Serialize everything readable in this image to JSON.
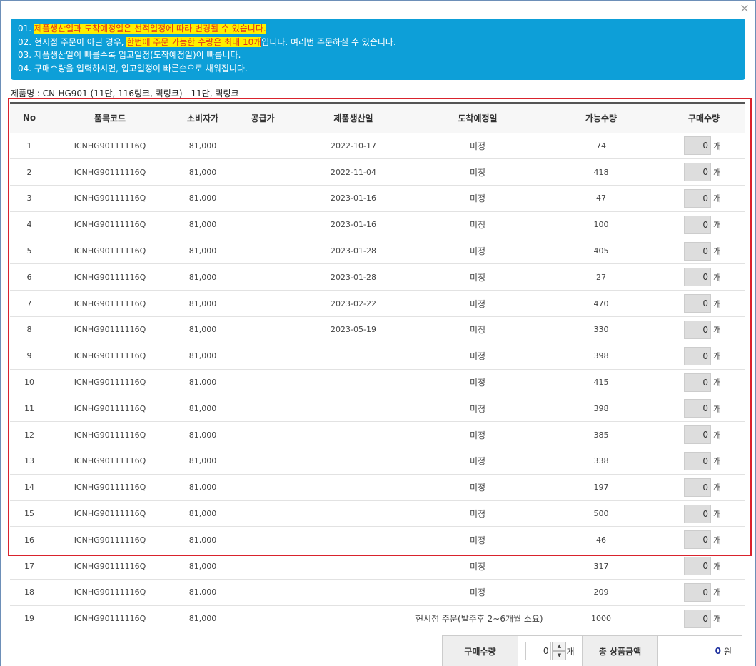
{
  "close_icon": "×",
  "notice": {
    "lines": [
      {
        "prefix": "01. ",
        "highlight": "제품생산일과 도착예정일은 선적일정에 따라 변경될 수 있습니다.",
        "suffix": ""
      },
      {
        "prefix": "02. 현시점 주문이 아닐 경우, ",
        "highlight": "한번에 주문 가능한 수량은 최대 10개",
        "suffix": "입니다. 여러번 주문하실 수 있습니다."
      },
      {
        "prefix": "03. 제품생산일이 빠를수록 입고일정(도착예정일)이 빠릅니다.",
        "highlight": "",
        "suffix": ""
      },
      {
        "prefix": "04. 구매수량을 입력하시면, 입고일정이 빠른순으로 채워집니다.",
        "highlight": "",
        "suffix": ""
      }
    ]
  },
  "product_name": "제품명 : CN-HG901 (11단, 116링크, 퀵링크) - 11단, 퀵링크",
  "table": {
    "headers": [
      "No",
      "품목코드",
      "소비자가",
      "공급가",
      "제품생산일",
      "도착예정일",
      "가능수량",
      "구매수량"
    ],
    "rows": [
      {
        "no": "1",
        "code": "ICNHG90111116Q",
        "price": "81,000",
        "supply": "",
        "prod": "2022-10-17",
        "arrival": "미정",
        "avail": "74",
        "qty": "0",
        "unit": "개"
      },
      {
        "no": "2",
        "code": "ICNHG90111116Q",
        "price": "81,000",
        "supply": "",
        "prod": "2022-11-04",
        "arrival": "미정",
        "avail": "418",
        "qty": "0",
        "unit": "개"
      },
      {
        "no": "3",
        "code": "ICNHG90111116Q",
        "price": "81,000",
        "supply": "",
        "prod": "2023-01-16",
        "arrival": "미정",
        "avail": "47",
        "qty": "0",
        "unit": "개"
      },
      {
        "no": "4",
        "code": "ICNHG90111116Q",
        "price": "81,000",
        "supply": "",
        "prod": "2023-01-16",
        "arrival": "미정",
        "avail": "100",
        "qty": "0",
        "unit": "개"
      },
      {
        "no": "5",
        "code": "ICNHG90111116Q",
        "price": "81,000",
        "supply": "",
        "prod": "2023-01-28",
        "arrival": "미정",
        "avail": "405",
        "qty": "0",
        "unit": "개"
      },
      {
        "no": "6",
        "code": "ICNHG90111116Q",
        "price": "81,000",
        "supply": "",
        "prod": "2023-01-28",
        "arrival": "미정",
        "avail": "27",
        "qty": "0",
        "unit": "개"
      },
      {
        "no": "7",
        "code": "ICNHG90111116Q",
        "price": "81,000",
        "supply": "",
        "prod": "2023-02-22",
        "arrival": "미정",
        "avail": "470",
        "qty": "0",
        "unit": "개"
      },
      {
        "no": "8",
        "code": "ICNHG90111116Q",
        "price": "81,000",
        "supply": "",
        "prod": "2023-05-19",
        "arrival": "미정",
        "avail": "330",
        "qty": "0",
        "unit": "개"
      },
      {
        "no": "9",
        "code": "ICNHG90111116Q",
        "price": "81,000",
        "supply": "",
        "prod": "",
        "arrival": "미정",
        "avail": "398",
        "qty": "0",
        "unit": "개"
      },
      {
        "no": "10",
        "code": "ICNHG90111116Q",
        "price": "81,000",
        "supply": "",
        "prod": "",
        "arrival": "미정",
        "avail": "415",
        "qty": "0",
        "unit": "개"
      },
      {
        "no": "11",
        "code": "ICNHG90111116Q",
        "price": "81,000",
        "supply": "",
        "prod": "",
        "arrival": "미정",
        "avail": "398",
        "qty": "0",
        "unit": "개"
      },
      {
        "no": "12",
        "code": "ICNHG90111116Q",
        "price": "81,000",
        "supply": "",
        "prod": "",
        "arrival": "미정",
        "avail": "385",
        "qty": "0",
        "unit": "개"
      },
      {
        "no": "13",
        "code": "ICNHG90111116Q",
        "price": "81,000",
        "supply": "",
        "prod": "",
        "arrival": "미정",
        "avail": "338",
        "qty": "0",
        "unit": "개"
      },
      {
        "no": "14",
        "code": "ICNHG90111116Q",
        "price": "81,000",
        "supply": "",
        "prod": "",
        "arrival": "미정",
        "avail": "197",
        "qty": "0",
        "unit": "개"
      },
      {
        "no": "15",
        "code": "ICNHG90111116Q",
        "price": "81,000",
        "supply": "",
        "prod": "",
        "arrival": "미정",
        "avail": "500",
        "qty": "0",
        "unit": "개"
      },
      {
        "no": "16",
        "code": "ICNHG90111116Q",
        "price": "81,000",
        "supply": "",
        "prod": "",
        "arrival": "미정",
        "avail": "46",
        "qty": "0",
        "unit": "개"
      },
      {
        "no": "17",
        "code": "ICNHG90111116Q",
        "price": "81,000",
        "supply": "",
        "prod": "",
        "arrival": "미정",
        "avail": "317",
        "qty": "0",
        "unit": "개"
      },
      {
        "no": "18",
        "code": "ICNHG90111116Q",
        "price": "81,000",
        "supply": "",
        "prod": "",
        "arrival": "미정",
        "avail": "209",
        "qty": "0",
        "unit": "개"
      },
      {
        "no": "19",
        "code": "ICNHG90111116Q",
        "price": "81,000",
        "supply": "",
        "prod": "",
        "arrival": "현시점 주문(발주후 2~6개월 소요)",
        "avail": "1000",
        "qty": "0",
        "unit": "개"
      }
    ]
  },
  "summary": {
    "qty_label": "구매수량",
    "qty_value": "0",
    "qty_unit": "개",
    "total_label": "총 상품금액",
    "total_value": "0",
    "total_unit": "원"
  },
  "colors": {
    "notice_bg": "#0d9fd8",
    "highlight": "#ffef00",
    "highlight_text": "#e0351b",
    "red_box": "#d9232d",
    "total": "#1d2f9e"
  }
}
